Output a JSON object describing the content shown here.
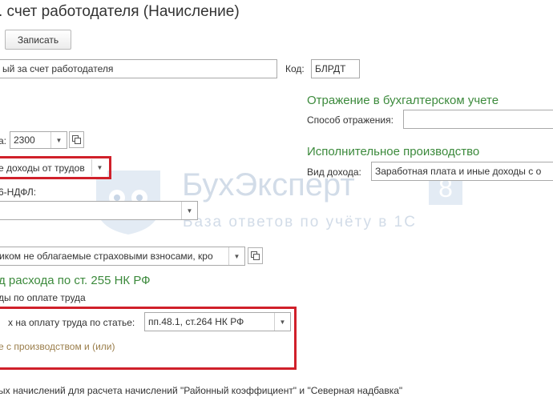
{
  "title": ". счет работодателя (Начисление)",
  "toolbar": {
    "save_label": "Записать"
  },
  "name_field": {
    "value": "ый за счет работодателя"
  },
  "code": {
    "label": "Код:",
    "value": "БЛРДТ"
  },
  "account_row": {
    "label": "а:",
    "value": "2300"
  },
  "income_type": {
    "value": "е доходы от трудов"
  },
  "ndfl_label": "6-НДФЛ:",
  "insurance": {
    "value": "иком не облагаемые страховыми взносами, кро"
  },
  "expense_heading": "д расхода по ст. 255 НК РФ",
  "expense_value": "ды по оплате труда",
  "article_row": {
    "label": "х на оплату труда по статье:",
    "value": "пп.48.1, ст.264 НК РФ"
  },
  "production_link": "е с производством и (или)",
  "bottom_text": "ых начислений для расчета начислений \"Районный коэффициент\" и \"Северная надбавка\"",
  "accounting": {
    "heading": "Отражение в бухгалтерском учете",
    "method_label": "Способ отражения:",
    "method_value": ""
  },
  "enforcement": {
    "heading": "Исполнительное производство",
    "income_label": "Вид дохода:",
    "income_value": "Заработная плата и иные доходы с о"
  },
  "watermark": {
    "brand": "БухЭксперт",
    "digit": "8",
    "tagline": "База ответов по учёту в 1С"
  },
  "colors": {
    "accent_green": "#3c8a3c",
    "highlight_red": "#d0202a",
    "link_tan": "#9a7d4a"
  }
}
